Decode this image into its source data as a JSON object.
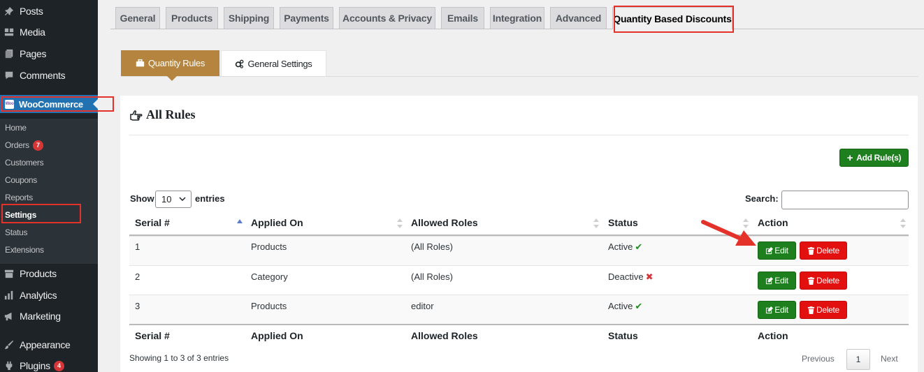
{
  "sidebar": {
    "top_items": [
      {
        "label": "Posts",
        "icon": "pushpin-icon"
      },
      {
        "label": "Media",
        "icon": "media-icon"
      },
      {
        "label": "Pages",
        "icon": "pages-icon"
      },
      {
        "label": "Comments",
        "icon": "comment-icon"
      }
    ],
    "woocommerce_label": "WooCommerce",
    "woocommerce_logo": "Woo",
    "submenu": [
      {
        "label": "Home"
      },
      {
        "label": "Orders",
        "badge": "7"
      },
      {
        "label": "Customers"
      },
      {
        "label": "Coupons"
      },
      {
        "label": "Reports"
      },
      {
        "label": "Settings"
      },
      {
        "label": "Status"
      },
      {
        "label": "Extensions"
      }
    ],
    "bottom_items": [
      {
        "label": "Products",
        "icon": "archive-icon"
      },
      {
        "label": "Analytics",
        "icon": "bar-chart-icon"
      },
      {
        "label": "Marketing",
        "icon": "megaphone-icon"
      },
      {
        "label": "Appearance",
        "icon": "paintbrush-icon"
      },
      {
        "label": "Plugins",
        "icon": "plugin-icon",
        "badge": "4"
      }
    ]
  },
  "nav_tabs": [
    {
      "label": "General"
    },
    {
      "label": "Products"
    },
    {
      "label": "Shipping"
    },
    {
      "label": "Payments"
    },
    {
      "label": "Accounts & Privacy"
    },
    {
      "label": "Emails"
    },
    {
      "label": "Integration"
    },
    {
      "label": "Advanced"
    },
    {
      "label": "Quantity Based Discounts",
      "active": true
    }
  ],
  "sub_tabs": {
    "quantity_rules": "Quantity Rules",
    "general_settings": "General Settings"
  },
  "card": {
    "title": "All Rules",
    "add_button": "Add Rule(s)"
  },
  "table_controls": {
    "show_label": "Show",
    "entries_value": "10",
    "entries_label": "entries",
    "search_label": "Search:",
    "search_value": ""
  },
  "table": {
    "columns": [
      "Serial #",
      "Applied On",
      "Allowed Roles",
      "Status",
      "Action"
    ],
    "rows": [
      {
        "serial": "1",
        "applied_on": "Products",
        "roles": "(All Roles)",
        "status": "Active",
        "status_mark": "✔"
      },
      {
        "serial": "2",
        "applied_on": "Category",
        "roles": "(All Roles)",
        "status": "Deactive",
        "status_mark": "✖"
      },
      {
        "serial": "3",
        "applied_on": "Products",
        "roles": "editor",
        "status": "Active",
        "status_mark": "✔"
      }
    ],
    "edit_label": "Edit",
    "delete_label": "Delete"
  },
  "pagination": {
    "info": "Showing 1 to 3 of 3 entries",
    "previous": "Previous",
    "current_page": "1",
    "next": "Next"
  },
  "colors": {
    "sidebar_bg": "#1d2327",
    "wp_blue": "#2271b1",
    "accent_brown": "#b5853f",
    "edit_green": "#1e7f1e",
    "delete_red": "#e31010",
    "highlight_red": "#e4322b"
  }
}
